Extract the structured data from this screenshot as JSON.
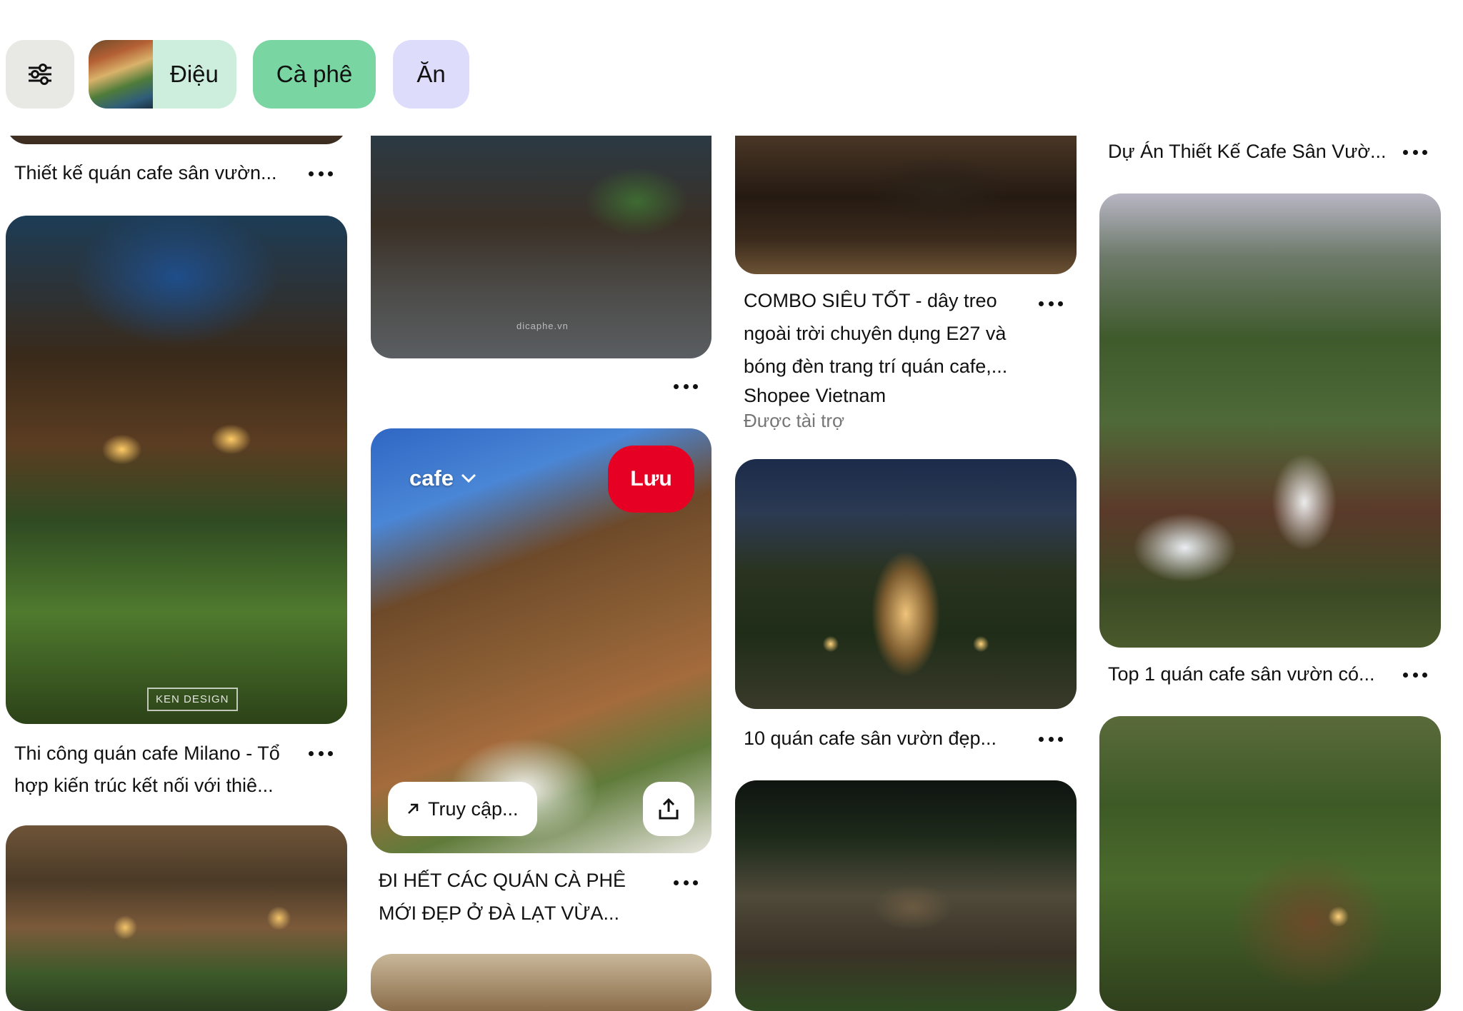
{
  "filters": {
    "filter_icon": "sliders-icon",
    "chips": [
      {
        "label": "Điệu",
        "color": "#cdeedd"
      },
      {
        "label": "Cà phê",
        "color": "#79d6a3"
      },
      {
        "label": "Ăn",
        "color": "#dedcfb"
      }
    ]
  },
  "pins": {
    "col1": [
      {
        "title": "Thiết kế quán cafe sân vườn..."
      },
      {
        "title_line1": "Thi công quán cafe Milano - Tổ",
        "title_line2": "hợp kiến trúc kết nối với thiê...",
        "watermark": "KEN DESIGN"
      }
    ],
    "col2": [
      {
        "watermark": "dicaphe.vn"
      },
      {
        "board": "cafe",
        "save": "Lưu",
        "visit": "Truy cập...",
        "title_line1": "ĐI HẾT CÁC QUÁN CÀ PHÊ",
        "title_line2": "MỚI ĐẸP Ở ĐÀ LẠT VỪA..."
      }
    ],
    "col3": [
      {
        "title_line1": "COMBO SIÊU TỐT - dây treo",
        "title_line2": "ngoài trời chuyên dụng E27 và",
        "title_line3": "bóng đèn trang trí quán cafe,...",
        "advertiser": "Shopee Vietnam",
        "sponsored": "Được tài trợ"
      },
      {
        "title": "10 quán cafe sân vườn đẹp..."
      }
    ],
    "col4": [
      {
        "title": "Dự Án Thiết Kế Cafe Sân Vườ..."
      },
      {
        "title": "Top 1 quán cafe sân vườn có..."
      }
    ]
  },
  "colors": {
    "save": "#e60023",
    "chip_text": "#111111",
    "muted": "#767676"
  }
}
